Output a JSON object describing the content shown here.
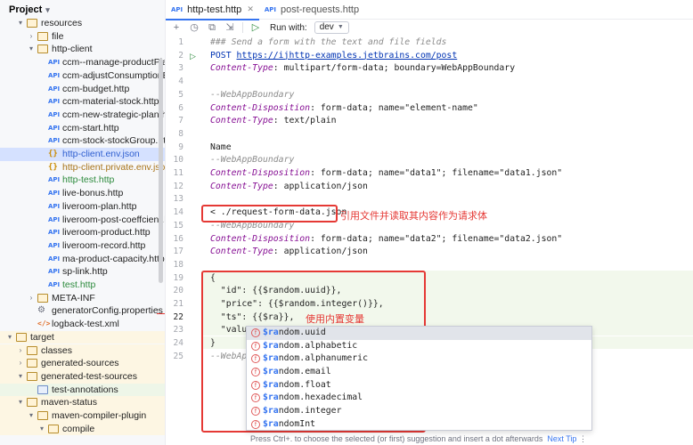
{
  "project": {
    "title": "Project",
    "tree": [
      {
        "label": "resources",
        "indent": 1,
        "arrow": "open",
        "icon": "folder-resources",
        "tone": "normal"
      },
      {
        "label": "file",
        "indent": 2,
        "arrow": "closed",
        "icon": "folder",
        "tone": "normal"
      },
      {
        "label": "http-client",
        "indent": 2,
        "arrow": "open",
        "icon": "folder",
        "tone": "normal"
      },
      {
        "label": "ccm--manage-productPlan.http",
        "indent": 3,
        "icon": "api",
        "tone": "normal"
      },
      {
        "label": "ccm-adjustConsumptionEnd.http",
        "indent": 3,
        "icon": "api",
        "tone": "normal"
      },
      {
        "label": "ccm-budget.http",
        "indent": 3,
        "icon": "api",
        "tone": "normal"
      },
      {
        "label": "ccm-material-stock.http",
        "indent": 3,
        "icon": "api",
        "tone": "normal"
      },
      {
        "label": "ccm-new-strategic-plan.http",
        "indent": 3,
        "icon": "api",
        "tone": "normal"
      },
      {
        "label": "ccm-start.http",
        "indent": 3,
        "icon": "api",
        "tone": "normal"
      },
      {
        "label": "ccm-stock-stockGroup.http",
        "indent": 3,
        "icon": "api",
        "tone": "normal"
      },
      {
        "label": "http-client.env.json",
        "indent": 3,
        "icon": "json",
        "tone": "blue",
        "selected": true
      },
      {
        "label": "http-client.private.env.json",
        "indent": 3,
        "icon": "json",
        "tone": "orange"
      },
      {
        "label": "http-test.http",
        "indent": 3,
        "icon": "api",
        "tone": "green"
      },
      {
        "label": "live-bonus.http",
        "indent": 3,
        "icon": "api",
        "tone": "normal"
      },
      {
        "label": "liveroom-plan.http",
        "indent": 3,
        "icon": "api",
        "tone": "normal"
      },
      {
        "label": "liveroom-post-coeffcient.http",
        "indent": 3,
        "icon": "api",
        "tone": "normal"
      },
      {
        "label": "liveroom-product.http",
        "indent": 3,
        "icon": "api",
        "tone": "normal"
      },
      {
        "label": "liveroom-record.http",
        "indent": 3,
        "icon": "api",
        "tone": "normal"
      },
      {
        "label": "ma-product-capacity.http",
        "indent": 3,
        "icon": "api",
        "tone": "normal"
      },
      {
        "label": "sp-link.http",
        "indent": 3,
        "icon": "api",
        "tone": "normal"
      },
      {
        "label": "test.http",
        "indent": 3,
        "icon": "api",
        "tone": "green"
      },
      {
        "label": "META-INF",
        "indent": 2,
        "arrow": "closed",
        "icon": "folder",
        "tone": "normal"
      },
      {
        "label": "generatorConfig.properties",
        "indent": 2,
        "icon": "gear",
        "tone": "normal"
      },
      {
        "label": "logback-test.xml",
        "indent": 2,
        "icon": "xml",
        "tone": "normal"
      },
      {
        "label": "target",
        "indent": 0,
        "arrow": "open",
        "icon": "folder-excluded",
        "tone": "normal",
        "bg": "yellow"
      },
      {
        "label": "classes",
        "indent": 1,
        "arrow": "closed",
        "icon": "folder-excluded",
        "tone": "normal",
        "bg": "yellow"
      },
      {
        "label": "generated-sources",
        "indent": 1,
        "arrow": "closed",
        "icon": "folder-excluded",
        "tone": "normal",
        "bg": "yellow"
      },
      {
        "label": "generated-test-sources",
        "indent": 1,
        "arrow": "open",
        "icon": "folder-excluded",
        "tone": "normal",
        "bg": "yellow"
      },
      {
        "label": "test-annotations",
        "indent": 2,
        "icon": "folder-test",
        "tone": "normal",
        "bg": "green"
      },
      {
        "label": "maven-status",
        "indent": 1,
        "arrow": "open",
        "icon": "folder-excluded",
        "tone": "normal",
        "bg": "yellow"
      },
      {
        "label": "maven-compiler-plugin",
        "indent": 2,
        "arrow": "open",
        "icon": "folder-excluded",
        "tone": "normal",
        "bg": "yellow"
      },
      {
        "label": "compile",
        "indent": 3,
        "arrow": "open",
        "icon": "folder-excluded",
        "tone": "normal",
        "bg": "yellow"
      }
    ]
  },
  "tabs": [
    {
      "label": "http-test.http",
      "active": true,
      "badge": "API"
    },
    {
      "label": "post-requests.http",
      "active": false,
      "badge": "API"
    }
  ],
  "toolbar": {
    "run_with_label": "Run with:",
    "env_value": "dev"
  },
  "editor": {
    "line_numbers": [
      "1",
      "2",
      "3",
      "4",
      "5",
      "6",
      "7",
      "8",
      "9",
      "10",
      "11",
      "12",
      "13",
      "14",
      "15",
      "16",
      "17",
      "18",
      "19",
      "20",
      "21",
      "22",
      "23",
      "24",
      "25"
    ],
    "current_line": "22",
    "lines": [
      [
        {
          "t": "### Send a form with the text and file fields",
          "c": "comment"
        }
      ],
      [
        {
          "t": "POST ",
          "c": "kw"
        },
        {
          "t": "https://ijhttp-examples.jetbrains.com/post",
          "c": "url"
        }
      ],
      [
        {
          "t": "Content-Type",
          "c": "hdr"
        },
        {
          "t": ": multipart/form-data; boundary=WebAppBoundary",
          "c": "val"
        }
      ],
      [],
      [
        {
          "t": "--WebAppBoundary",
          "c": "comment"
        }
      ],
      [
        {
          "t": "Content-Disposition",
          "c": "hdr"
        },
        {
          "t": ": form-data; name=\"element-name\"",
          "c": "val"
        }
      ],
      [
        {
          "t": "Content-Type",
          "c": "hdr"
        },
        {
          "t": ": text/plain",
          "c": "val"
        }
      ],
      [],
      [
        {
          "t": "Name",
          "c": "val"
        }
      ],
      [
        {
          "t": "--WebAppBoundary",
          "c": "comment"
        }
      ],
      [
        {
          "t": "Content-Disposition",
          "c": "hdr"
        },
        {
          "t": ": form-data; name=\"data1\"; filename=\"data1.json\"",
          "c": "val"
        }
      ],
      [
        {
          "t": "Content-Type",
          "c": "hdr"
        },
        {
          "t": ": application/json",
          "c": "val"
        }
      ],
      [],
      [
        {
          "t": "< ./request-form-data.json",
          "c": "val"
        }
      ],
      [
        {
          "t": "--WebAppBoundary",
          "c": "comment"
        }
      ],
      [
        {
          "t": "Content-Disposition",
          "c": "hdr"
        },
        {
          "t": ": form-data; name=\"data2\"; filename=\"data2.json\"",
          "c": "val"
        }
      ],
      [
        {
          "t": "Content-Type",
          "c": "hdr"
        },
        {
          "t": ": application/json",
          "c": "val"
        }
      ],
      [],
      [
        {
          "t": "{",
          "c": "val"
        }
      ],
      [
        {
          "t": "  \"id\": {{$random.uuid}},",
          "c": "val"
        }
      ],
      [
        {
          "t": "  \"price\": {{$random.integer()}},",
          "c": "val"
        }
      ],
      [
        {
          "t": "  \"ts\": {{$ra}},",
          "c": "val"
        }
      ],
      [
        {
          "t": "  \"valu",
          "c": "val"
        }
      ],
      [
        {
          "t": "}",
          "c": "val"
        }
      ],
      [
        {
          "t": "--WebAp",
          "c": "comment"
        }
      ]
    ]
  },
  "annotations": {
    "file_body": "引用文件并读取其内容作为请求体",
    "builtin_vars": "使用内置变量"
  },
  "completion": {
    "items": [
      {
        "prefix": "$ra",
        "rest": "ndom.uuid",
        "selected": true
      },
      {
        "prefix": "$ra",
        "rest": "ndom.alphabetic"
      },
      {
        "prefix": "$ra",
        "rest": "ndom.alphanumeric"
      },
      {
        "prefix": "$ra",
        "rest": "ndom.email"
      },
      {
        "prefix": "$ra",
        "rest": "ndom.float"
      },
      {
        "prefix": "$ra",
        "rest": "ndom.hexadecimal"
      },
      {
        "prefix": "$ra",
        "rest": "ndom.integer"
      },
      {
        "prefix": "$ra",
        "rest": "ndomInt"
      }
    ],
    "footer_hint": "Press Ctrl+. to choose the selected (or first) suggestion and insert a dot afterwards",
    "next_tip": "Next Tip"
  },
  "colors": {
    "accent": "#3574f0",
    "annotation_red": "#e53935",
    "run_green": "#2c8a3c"
  }
}
